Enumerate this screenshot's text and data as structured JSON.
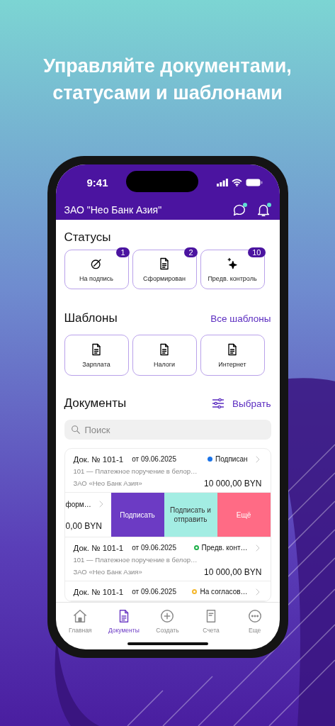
{
  "headline": "Управляйте документами, статусами и шаблонами",
  "status_bar": {
    "time": "9:41"
  },
  "header": {
    "title": "ЗАО \"Нео Банк Азия\"",
    "chat_unread": true,
    "bell_unread": true
  },
  "statuses": {
    "title": "Статусы",
    "items": [
      {
        "label": "На подпись",
        "count": "1"
      },
      {
        "label": "Сформирован",
        "count": "2"
      },
      {
        "label": "Предв. контроль",
        "count": "10"
      }
    ]
  },
  "templates": {
    "title": "Шаблоны",
    "link": "Все шаблоны",
    "items": [
      {
        "label": "Зарплата"
      },
      {
        "label": "Налоги"
      },
      {
        "label": "Интернет"
      }
    ]
  },
  "documents": {
    "title": "Документы",
    "select": "Выбрать",
    "search": {
      "placeholder": "Поиск"
    },
    "rows": [
      {
        "kind": "full",
        "number": "Док. № 101-1",
        "date": "от 09.06.2025",
        "status": "Подписан",
        "color": "#1a73e8",
        "hollow": false,
        "description": "101 — Платежное поручение в белор…",
        "company": "ЗАО «Нео Банк Азия»",
        "amount": "10 000,00 BYN"
      },
      {
        "kind": "swiped",
        "status": "форм…",
        "amount": "0,00 BYN",
        "actions": [
          {
            "label": "Подписать",
            "color": "#6c3bc4"
          },
          {
            "label": "Подписать и отправить",
            "color": "#a3ede3"
          },
          {
            "label": "Ещё",
            "color": "#ff6b85"
          }
        ]
      },
      {
        "kind": "full",
        "number": "Док. № 101-1",
        "date": "от 09.06.2025",
        "status": "Предв. конт…",
        "color": "#22b14c",
        "hollow": true,
        "description": "101 — Платежное поручение в белор…",
        "company": "ЗАО «Нео Банк Азия»",
        "amount": "10 000,00 BYN"
      },
      {
        "kind": "partial",
        "number": "Док. № 101-1",
        "date": "от 09.06.2025",
        "status": "На согласов…",
        "color": "#f5b82e",
        "hollow": true
      }
    ]
  },
  "tab_bar": [
    {
      "label": "Главная",
      "selected": false
    },
    {
      "label": "Документы",
      "selected": true
    },
    {
      "label": "Создать",
      "selected": false
    },
    {
      "label": "Счета",
      "selected": false
    },
    {
      "label": "Еще",
      "selected": false
    }
  ]
}
